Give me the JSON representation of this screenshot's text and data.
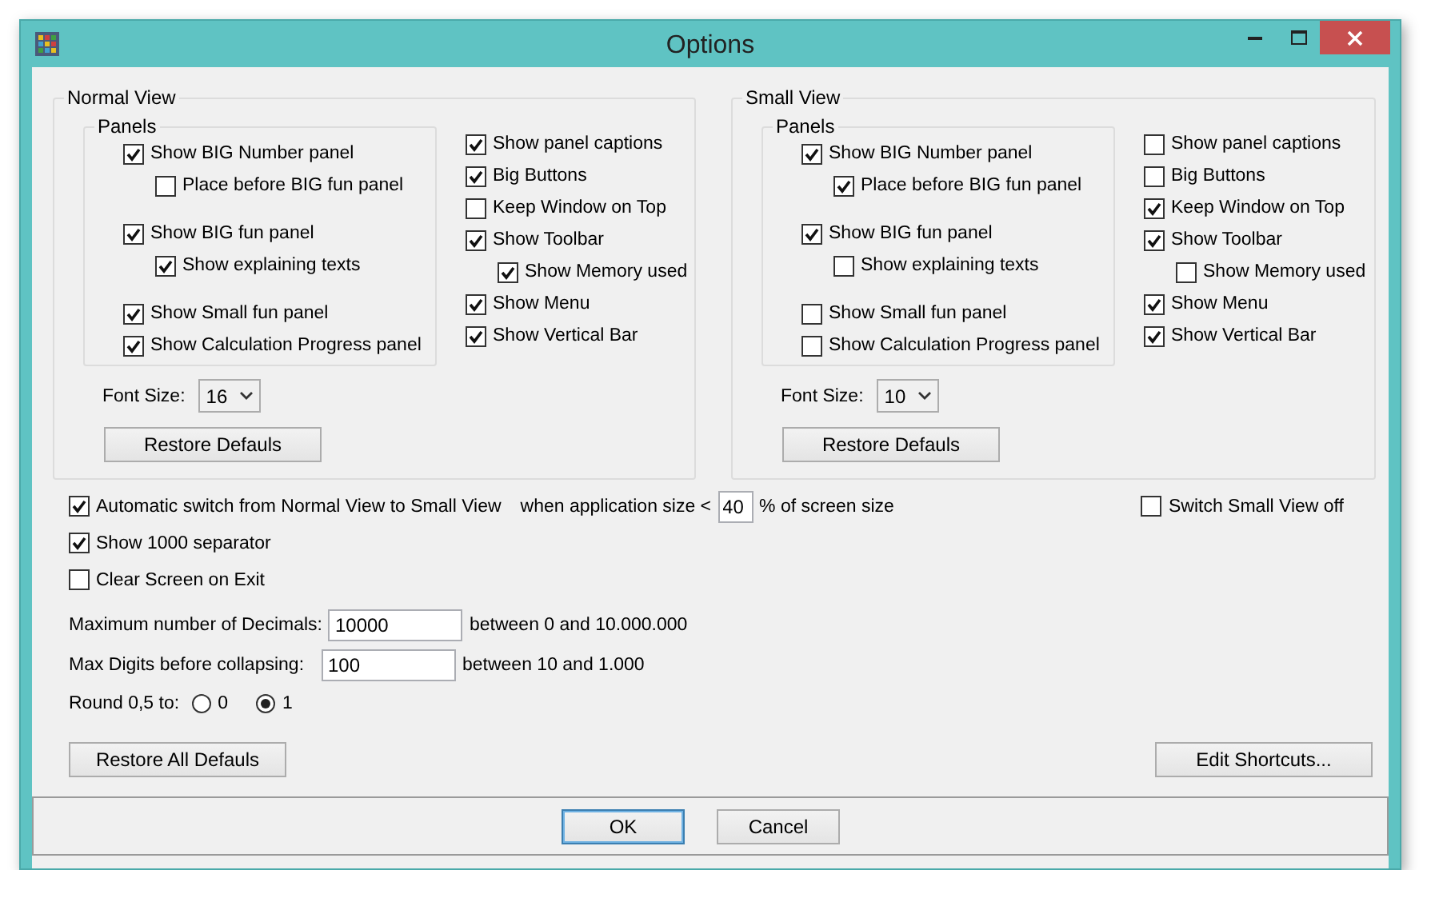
{
  "window": {
    "title": "Options"
  },
  "views": [
    {
      "title": "Normal View",
      "panels_title": "Panels",
      "panels": [
        {
          "label": "Show BIG Number panel",
          "checked": true,
          "children": [
            {
              "label": "Place before BIG fun panel",
              "checked": false
            }
          ]
        },
        {
          "label": "Show BIG fun panel",
          "checked": true,
          "children": [
            {
              "label": "Show explaining texts",
              "checked": true
            }
          ]
        },
        {
          "label": "Show Small fun panel",
          "checked": true
        },
        {
          "label": "Show Calculation Progress panel",
          "checked": true
        }
      ],
      "options": [
        {
          "label": "Show panel captions",
          "checked": true
        },
        {
          "label": "Big Buttons",
          "checked": true
        },
        {
          "label": "Keep Window on Top",
          "checked": false
        },
        {
          "label": "Show Toolbar",
          "checked": true,
          "children": [
            {
              "label": "Show Memory used",
              "checked": true
            }
          ]
        },
        {
          "label": "Show Menu",
          "checked": true
        },
        {
          "label": "Show Vertical Bar",
          "checked": true
        }
      ],
      "font_size": {
        "label": "Font Size:",
        "value": "16"
      },
      "restore_button": "Restore Defauls"
    },
    {
      "title": "Small View",
      "panels_title": "Panels",
      "panels": [
        {
          "label": "Show BIG Number panel",
          "checked": true,
          "children": [
            {
              "label": "Place before BIG fun panel",
              "checked": true
            }
          ]
        },
        {
          "label": "Show BIG fun panel",
          "checked": true,
          "children": [
            {
              "label": "Show explaining texts",
              "checked": false
            }
          ]
        },
        {
          "label": "Show Small fun panel",
          "checked": false
        },
        {
          "label": "Show Calculation Progress panel",
          "checked": false
        }
      ],
      "options": [
        {
          "label": "Show panel captions",
          "checked": false
        },
        {
          "label": "Big Buttons",
          "checked": false
        },
        {
          "label": "Keep Window on Top",
          "checked": true
        },
        {
          "label": "Show Toolbar",
          "checked": true,
          "children": [
            {
              "label": "Show Memory used",
              "checked": false
            }
          ]
        },
        {
          "label": "Show Menu",
          "checked": true
        },
        {
          "label": "Show Vertical Bar",
          "checked": true
        }
      ],
      "font_size": {
        "label": "Font Size:",
        "value": "10"
      },
      "restore_button": "Restore Defauls"
    }
  ],
  "auto_switch": {
    "label": "Automatic switch from Normal View to Small View",
    "checked": true,
    "before": "when application size <",
    "value": "40",
    "after": "% of screen size"
  },
  "switch_off": {
    "label": "Switch Small View off",
    "checked": false
  },
  "checkboxes": [
    {
      "label": "Show 1000 separator",
      "checked": true
    },
    {
      "label": "Clear Screen on Exit",
      "checked": false
    }
  ],
  "fields": [
    {
      "label": "Maximum number of Decimals:",
      "value": "10000",
      "hint": "between 0 and 10.000.000"
    },
    {
      "label": "Max Digits before collapsing:",
      "value": "100",
      "hint": "between 10 and 1.000"
    }
  ],
  "round": {
    "label": "Round 0,5 to:",
    "options": [
      {
        "label": "0",
        "selected": false
      },
      {
        "label": "1",
        "selected": true
      }
    ]
  },
  "restore_all_button": "Restore All Defauls",
  "shortcuts_button": "Edit Shortcuts...",
  "buttons": [
    {
      "label": "OK",
      "default": true
    },
    {
      "label": "Cancel",
      "default": false
    }
  ]
}
